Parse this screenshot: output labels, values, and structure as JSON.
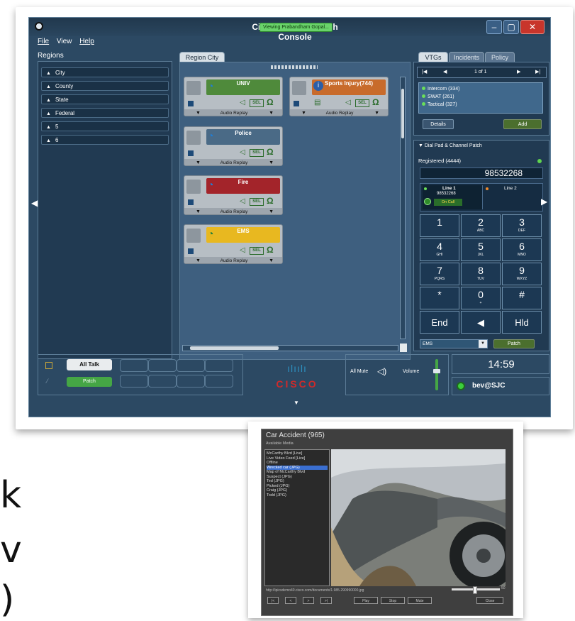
{
  "slide_letters": [
    "k",
    "v",
    ")"
  ],
  "window": {
    "title": "Cisco IPICS Dispatch Console",
    "viewing_badge": "Viewing Prabandham Gopal...",
    "controls": [
      "–",
      "▢",
      "✕"
    ]
  },
  "menu": {
    "file": "File",
    "view": "View",
    "help": "Help"
  },
  "regions": {
    "label": "Regions",
    "items": [
      "City",
      "County",
      "State",
      "Federal",
      "5",
      "6"
    ]
  },
  "center": {
    "tab": "Region City",
    "channels": [
      {
        "name": "UNIV",
        "footer": "Audio Replay",
        "color": "#4f8a3b"
      },
      {
        "name": "Sports Injury(744)",
        "footer": "Audio Replay",
        "color": "#c86b2b"
      },
      {
        "name": "Police",
        "footer": "Audio Replay",
        "color": "#4a6a86"
      },
      {
        "name": "Fire",
        "footer": "Audio Replay",
        "color": "#a3242a"
      },
      {
        "name": "EMS",
        "footer": "Audio Replay",
        "color": "#e8b820"
      }
    ],
    "sel_label": "SEL"
  },
  "right": {
    "tabs": [
      "VTGs",
      "Incidents",
      "Policy"
    ],
    "pager": "1 of 1",
    "vtgs": [
      "Intercom (334)",
      "SWAT (261)",
      "Tactical (327)"
    ],
    "details_btn": "Details",
    "add_btn": "Add",
    "dialpad_title": "Dial Pad & Channel Patch",
    "registered": "Registered (4444)",
    "dial_number": "98532268",
    "line1": {
      "label": "Line 1",
      "number": "98532268",
      "status": "On Call"
    },
    "line2": {
      "label": "Line 2"
    },
    "keys": [
      {
        "main": "1",
        "sub": ""
      },
      {
        "main": "2",
        "sub": "ABC"
      },
      {
        "main": "3",
        "sub": "DEF"
      },
      {
        "main": "4",
        "sub": "GHI"
      },
      {
        "main": "5",
        "sub": "JKL"
      },
      {
        "main": "6",
        "sub": "MNO"
      },
      {
        "main": "7",
        "sub": "PQRS"
      },
      {
        "main": "8",
        "sub": "TUV"
      },
      {
        "main": "9",
        "sub": "WXYZ"
      },
      {
        "main": "*",
        "sub": ""
      },
      {
        "main": "0",
        "sub": "+"
      },
      {
        "main": "#",
        "sub": ""
      },
      {
        "main": "End",
        "sub": ""
      },
      {
        "main": "◀",
        "sub": ""
      },
      {
        "main": "Hld",
        "sub": ""
      }
    ],
    "patch_select": "EMS",
    "patch_btn": "Patch"
  },
  "bottom": {
    "all_talk": "All Talk",
    "patch": "Patch",
    "brand": "CISCO",
    "all_mute": "All Mute",
    "volume": "Volume",
    "time": "14:59",
    "user": "bev@SJC"
  },
  "media": {
    "title": "Car Accident (965)",
    "available_label": "Available Media",
    "items": [
      "McCarthy Blvd [Live]",
      "Live Video Feed [Live]",
      "Offline",
      "Wrecked car (JPG)",
      "Map of McCarthy Blvd",
      "Suspect (JPG)",
      "Ted (JPG)",
      "Picked (JPG)",
      "Craig (JPG)",
      "Todd (JPG)"
    ],
    "selected_index": 3,
    "url": "http://ipicsdemo40.cisco.com/documents/1.985.290990000.jpg",
    "volume_value": "50",
    "controls": [
      "|<",
      "<",
      ">",
      ">|"
    ],
    "play_buttons": [
      "Play",
      "Stop",
      "Mute"
    ],
    "close": "Close"
  }
}
